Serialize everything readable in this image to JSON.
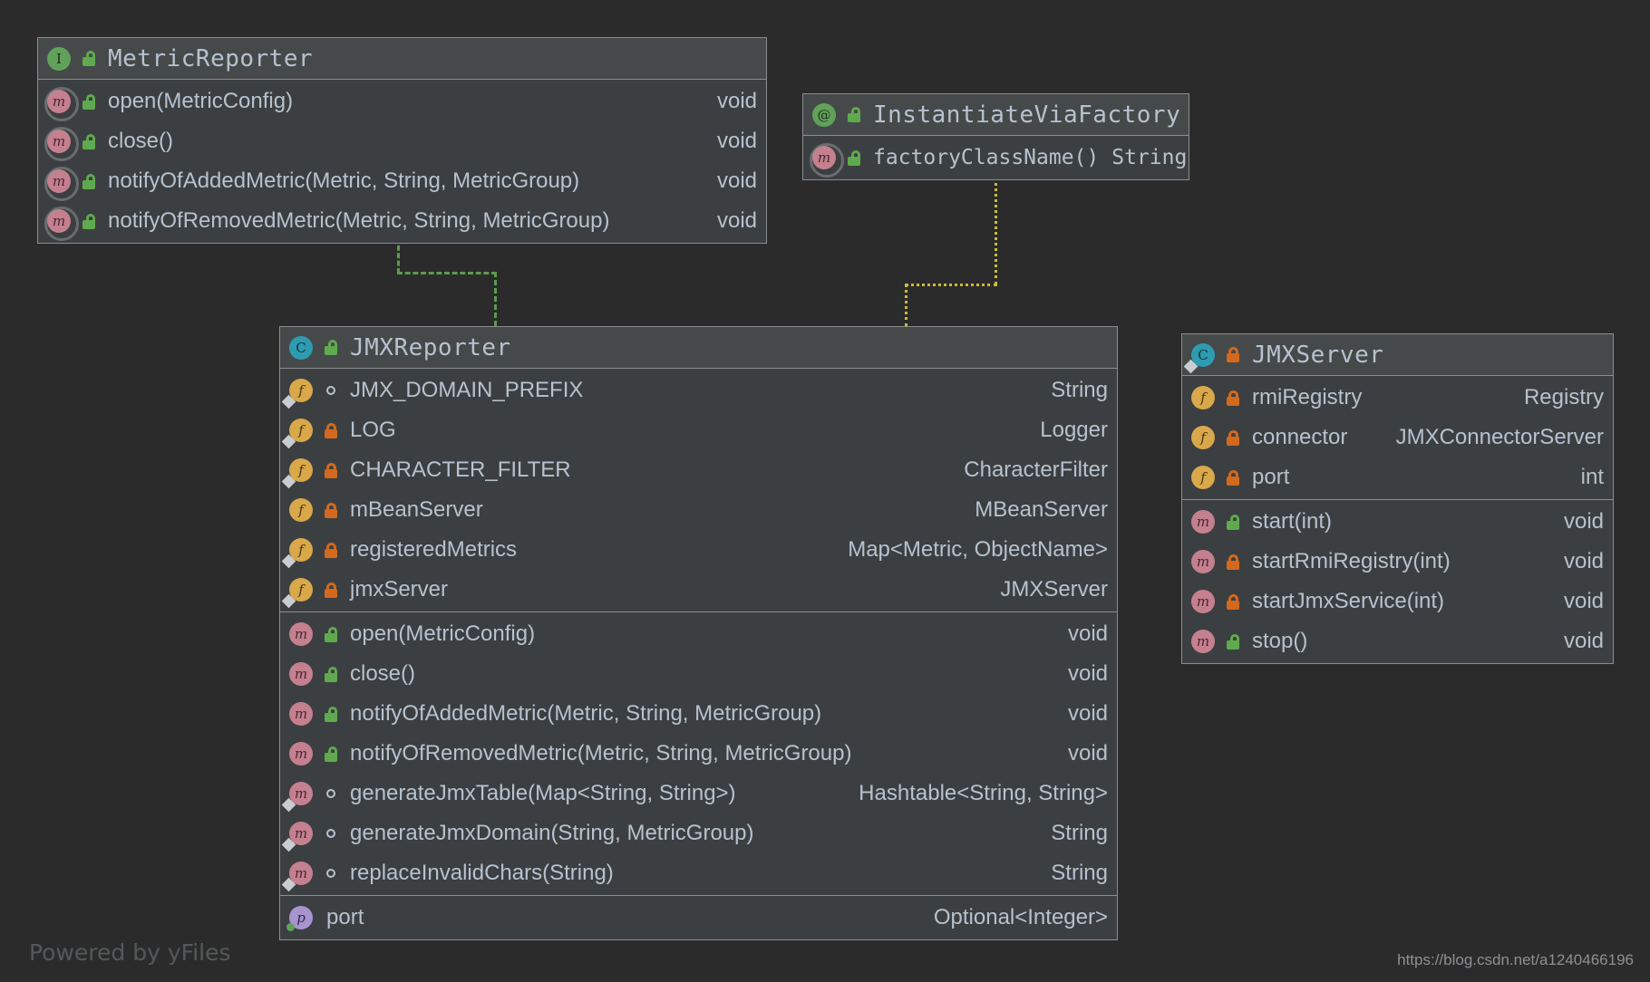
{
  "diagram": {
    "background": "#2b2b2b",
    "watermark_left": "Powered by yFiles",
    "watermark_right": "https://blog.csdn.net/a1240466196"
  },
  "classes": {
    "metric_reporter": {
      "name": "MetricReporter",
      "stereotype": "interface",
      "icon": "interface-icon",
      "visibility": "public",
      "members": [
        {
          "icon": "method-icon",
          "visibility": "public",
          "name": "open(MetricConfig)",
          "type": "void"
        },
        {
          "icon": "method-icon",
          "visibility": "public",
          "name": "close()",
          "type": "void"
        },
        {
          "icon": "method-icon",
          "visibility": "public",
          "name": "notifyOfAddedMetric(Metric, String, MetricGroup)",
          "type": "void"
        },
        {
          "icon": "method-icon",
          "visibility": "public",
          "name": "notifyOfRemovedMetric(Metric, String, MetricGroup)",
          "type": "void"
        }
      ]
    },
    "instantiate_via_factory": {
      "name": "InstantiateViaFactory",
      "stereotype": "annotation",
      "icon": "annotation-icon",
      "visibility": "public",
      "members": [
        {
          "icon": "method-icon",
          "visibility": "public",
          "name": "factoryClassName()",
          "type": "String"
        }
      ]
    },
    "jmx_reporter": {
      "name": "JMXReporter",
      "stereotype": "class",
      "icon": "class-icon",
      "visibility": "public",
      "fields": [
        {
          "icon": "field-icon",
          "visibility": "package",
          "name": "JMX_DOMAIN_PREFIX",
          "type": "String"
        },
        {
          "icon": "field-icon",
          "visibility": "private",
          "name": "LOG",
          "type": "Logger"
        },
        {
          "icon": "field-icon",
          "visibility": "private",
          "name": "CHARACTER_FILTER",
          "type": "CharacterFilter"
        },
        {
          "icon": "field-icon",
          "visibility": "private",
          "name": "mBeanServer",
          "type": "MBeanServer"
        },
        {
          "icon": "field-icon",
          "visibility": "private",
          "name": "registeredMetrics",
          "type": "Map<Metric, ObjectName>"
        },
        {
          "icon": "field-icon",
          "visibility": "private",
          "name": "jmxServer",
          "type": "JMXServer"
        }
      ],
      "methods": [
        {
          "icon": "method-icon",
          "visibility": "public",
          "name": "open(MetricConfig)",
          "type": "void"
        },
        {
          "icon": "method-icon",
          "visibility": "public",
          "name": "close()",
          "type": "void"
        },
        {
          "icon": "method-icon",
          "visibility": "public",
          "name": "notifyOfAddedMetric(Metric, String, MetricGroup)",
          "type": "void"
        },
        {
          "icon": "method-icon",
          "visibility": "public",
          "name": "notifyOfRemovedMetric(Metric, String, MetricGroup)",
          "type": "void"
        },
        {
          "icon": "method-icon",
          "visibility": "package",
          "name": "generateJmxTable(Map<String, String>)",
          "type": "Hashtable<String, String>"
        },
        {
          "icon": "method-icon",
          "visibility": "package",
          "name": "generateJmxDomain(String, MetricGroup)",
          "type": "String"
        },
        {
          "icon": "method-icon",
          "visibility": "package",
          "name": "replaceInvalidChars(String)",
          "type": "String"
        }
      ],
      "properties": [
        {
          "icon": "property-icon",
          "visibility": "public",
          "name": "port",
          "type": "Optional<Integer>"
        }
      ]
    },
    "jmx_server": {
      "name": "JMXServer",
      "stereotype": "class",
      "icon": "class-icon",
      "visibility": "private",
      "fields": [
        {
          "icon": "field-icon",
          "visibility": "private",
          "name": "rmiRegistry",
          "type": "Registry"
        },
        {
          "icon": "field-icon",
          "visibility": "private",
          "name": "connector",
          "type": "JMXConnectorServer"
        },
        {
          "icon": "field-icon",
          "visibility": "private",
          "name": "port",
          "type": "int"
        }
      ],
      "methods": [
        {
          "icon": "method-icon",
          "visibility": "public",
          "name": "start(int)",
          "type": "void"
        },
        {
          "icon": "method-icon",
          "visibility": "private",
          "name": "startRmiRegistry(int)",
          "type": "void"
        },
        {
          "icon": "method-icon",
          "visibility": "private",
          "name": "startJmxService(int)",
          "type": "void"
        },
        {
          "icon": "method-icon",
          "visibility": "public",
          "name": "stop()",
          "type": "void"
        }
      ]
    }
  },
  "connectors": [
    {
      "name": "realization-metricreporter-jmxreporter",
      "style": "dashed",
      "color": "#5d9b4e",
      "arrow": "hollow-triangle-filled"
    },
    {
      "name": "annotation-link-instantiateviafactory-jmxreporter",
      "style": "dotted",
      "color": "#c8bb3a",
      "arrow": "none"
    }
  ]
}
